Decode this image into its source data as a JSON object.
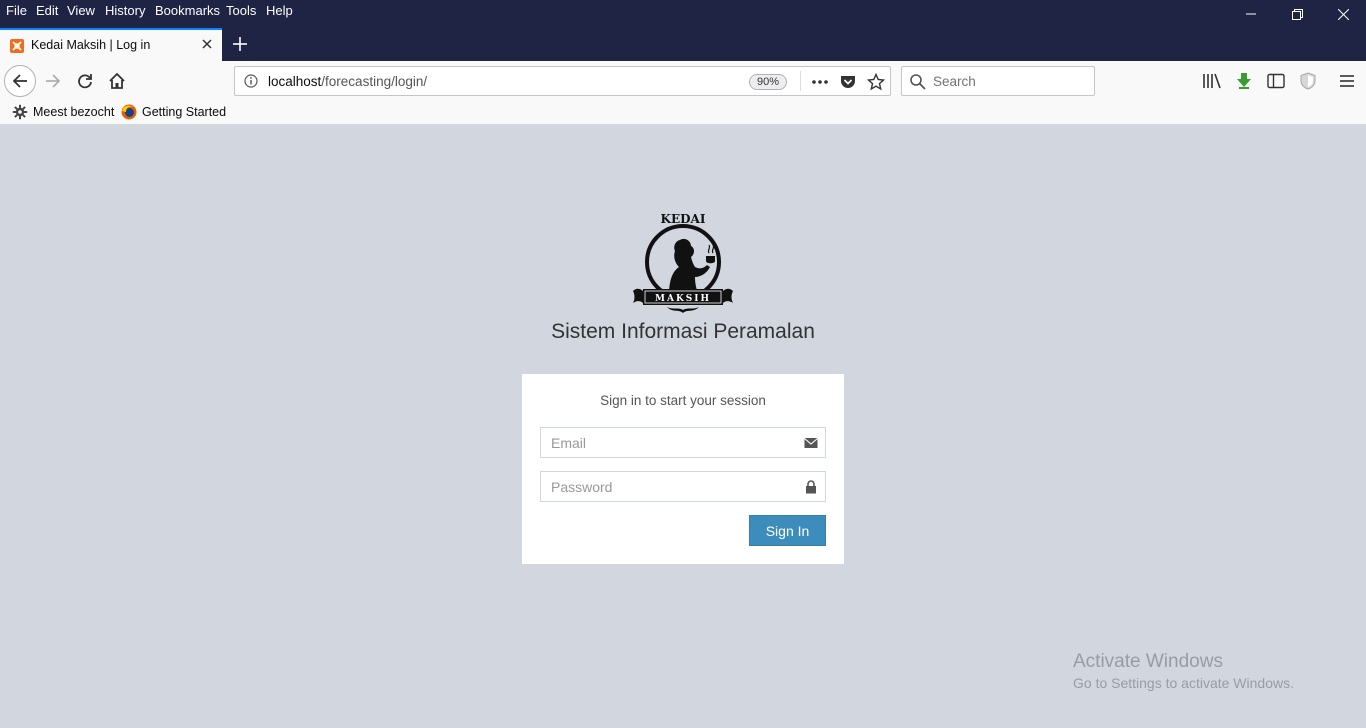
{
  "browser": {
    "menu": [
      {
        "label": "File"
      },
      {
        "label": "Edit"
      },
      {
        "label": "View"
      },
      {
        "label": "History"
      },
      {
        "label": "Bookmarks"
      },
      {
        "label": "Tools"
      },
      {
        "label": "Help"
      }
    ],
    "tab": {
      "title": "Kedai Maksih | Log in"
    },
    "url": {
      "host": "localhost",
      "path": "/forecasting/login/",
      "zoom": "90%"
    },
    "search": {
      "placeholder": "Search"
    },
    "bookmarks": [
      {
        "label": "Meest bezocht",
        "icon": "gear-icon"
      },
      {
        "label": "Getting Started",
        "icon": "firefox-icon"
      }
    ],
    "colors": {
      "chrome_dark": "#1f2344",
      "tab_accent": "#0a84ff"
    }
  },
  "page": {
    "logo": {
      "top_text": "KEDAI",
      "bottom_text": "MAKSIH"
    },
    "title": "Sistem Informasi Peramalan",
    "login": {
      "message": "Sign in to start your session",
      "email_placeholder": "Email",
      "password_placeholder": "Password",
      "submit_label": "Sign In"
    },
    "colors": {
      "background": "#d2d6de",
      "primary": "#3c8dbc"
    }
  },
  "os": {
    "watermark_title": "Activate Windows",
    "watermark_sub": "Go to Settings to activate Windows."
  }
}
